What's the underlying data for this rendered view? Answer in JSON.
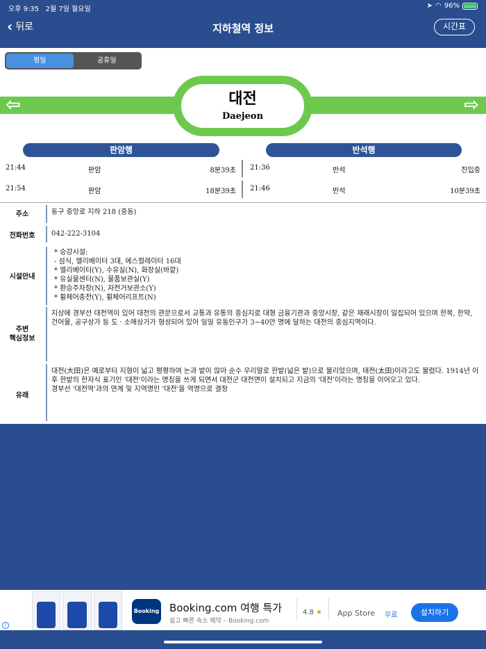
{
  "status": {
    "time": "오후 9:35",
    "date": "2월 7일 월요일",
    "battery": "96%"
  },
  "nav": {
    "back_label": "뒤로",
    "title": "지하철역 정보",
    "timetable_label": "시간표"
  },
  "segment": {
    "options": [
      "평일",
      "공휴일"
    ],
    "selected": "평일"
  },
  "station": {
    "name_ko": "대전",
    "name_en": "Daejeon",
    "line_color": "#6dc94e"
  },
  "directions": [
    {
      "header": "판암행",
      "trains": [
        {
          "time": "21:44",
          "dest": "판암",
          "remain": "8분39초"
        },
        {
          "time": "21:54",
          "dest": "판암",
          "remain": "18분39초"
        }
      ]
    },
    {
      "header": "반석행",
      "trains": [
        {
          "time": "21:36",
          "dest": "반석",
          "remain": "진입중"
        },
        {
          "time": "21:46",
          "dest": "반석",
          "remain": "10분39초"
        }
      ]
    }
  ],
  "info": {
    "address": {
      "label": "주소",
      "value": "동구 중앙로 지하 218 (중동)"
    },
    "phone": {
      "label": "전화번호",
      "value": "042-222-3104"
    },
    "facilities": {
      "label": "시설안내",
      "lines": [
        "* 승강시설:",
        "- 섬식, 엘리베이터 3대,  에스컬레이터 16대",
        "* 엘리베이터(Y), 수유실(N), 화장실(바깥)",
        "* 유실물센터(N), 물품보관실(Y)",
        "* 환승주차장(N), 자전거보관소(Y)",
        "* 휠체어충전(Y), 휠체어리프트(N)"
      ]
    },
    "nearby": {
      "label_line1": "주변",
      "label_line2": "핵심정보",
      "text": "지상에 경부선 대전역이 있어 대전의 관문으로서 교통과 유통의 중심지로 대형 금융기관과 중앙시장, 같은 재래시장이 밀집되어 있으며 한복, 한약, 건어물, 공구상가 등 도ㆍ소매상가가 형성되어 있어 일일 유동인구가 3~40만 명에 달하는 대전의 중심지역이다."
    },
    "origin": {
      "label": "유래",
      "text1": "대전(大田)은 예로부터 지형이 넓고 평평하여 논과 밭이 많아 순수 우리말로 한밭(넓은 밭)으로 불리었으며, 태전(太田)이라고도 불렸다. 1914년 이후 한밭의 한자식 표기인 '대전'이라는 명칭을 쓰게 되면서 대전군 대전면이 설치되고 지금의 '대전'이라는 명칭을 이어오고 있다.",
      "text2": "경부선 '대전역'과의 연계 및 지역명인 '대전'을 역명으로 결정"
    }
  },
  "ad": {
    "logo_text": "Booking",
    "title": "Booking.com 여행 특가",
    "subtitle": "쉽고 빠른 숙소 예약 – Booking.com",
    "rating": "4.8",
    "store": "App Store",
    "price": "무료",
    "install_label": "설치하기",
    "info_glyph": "i"
  }
}
